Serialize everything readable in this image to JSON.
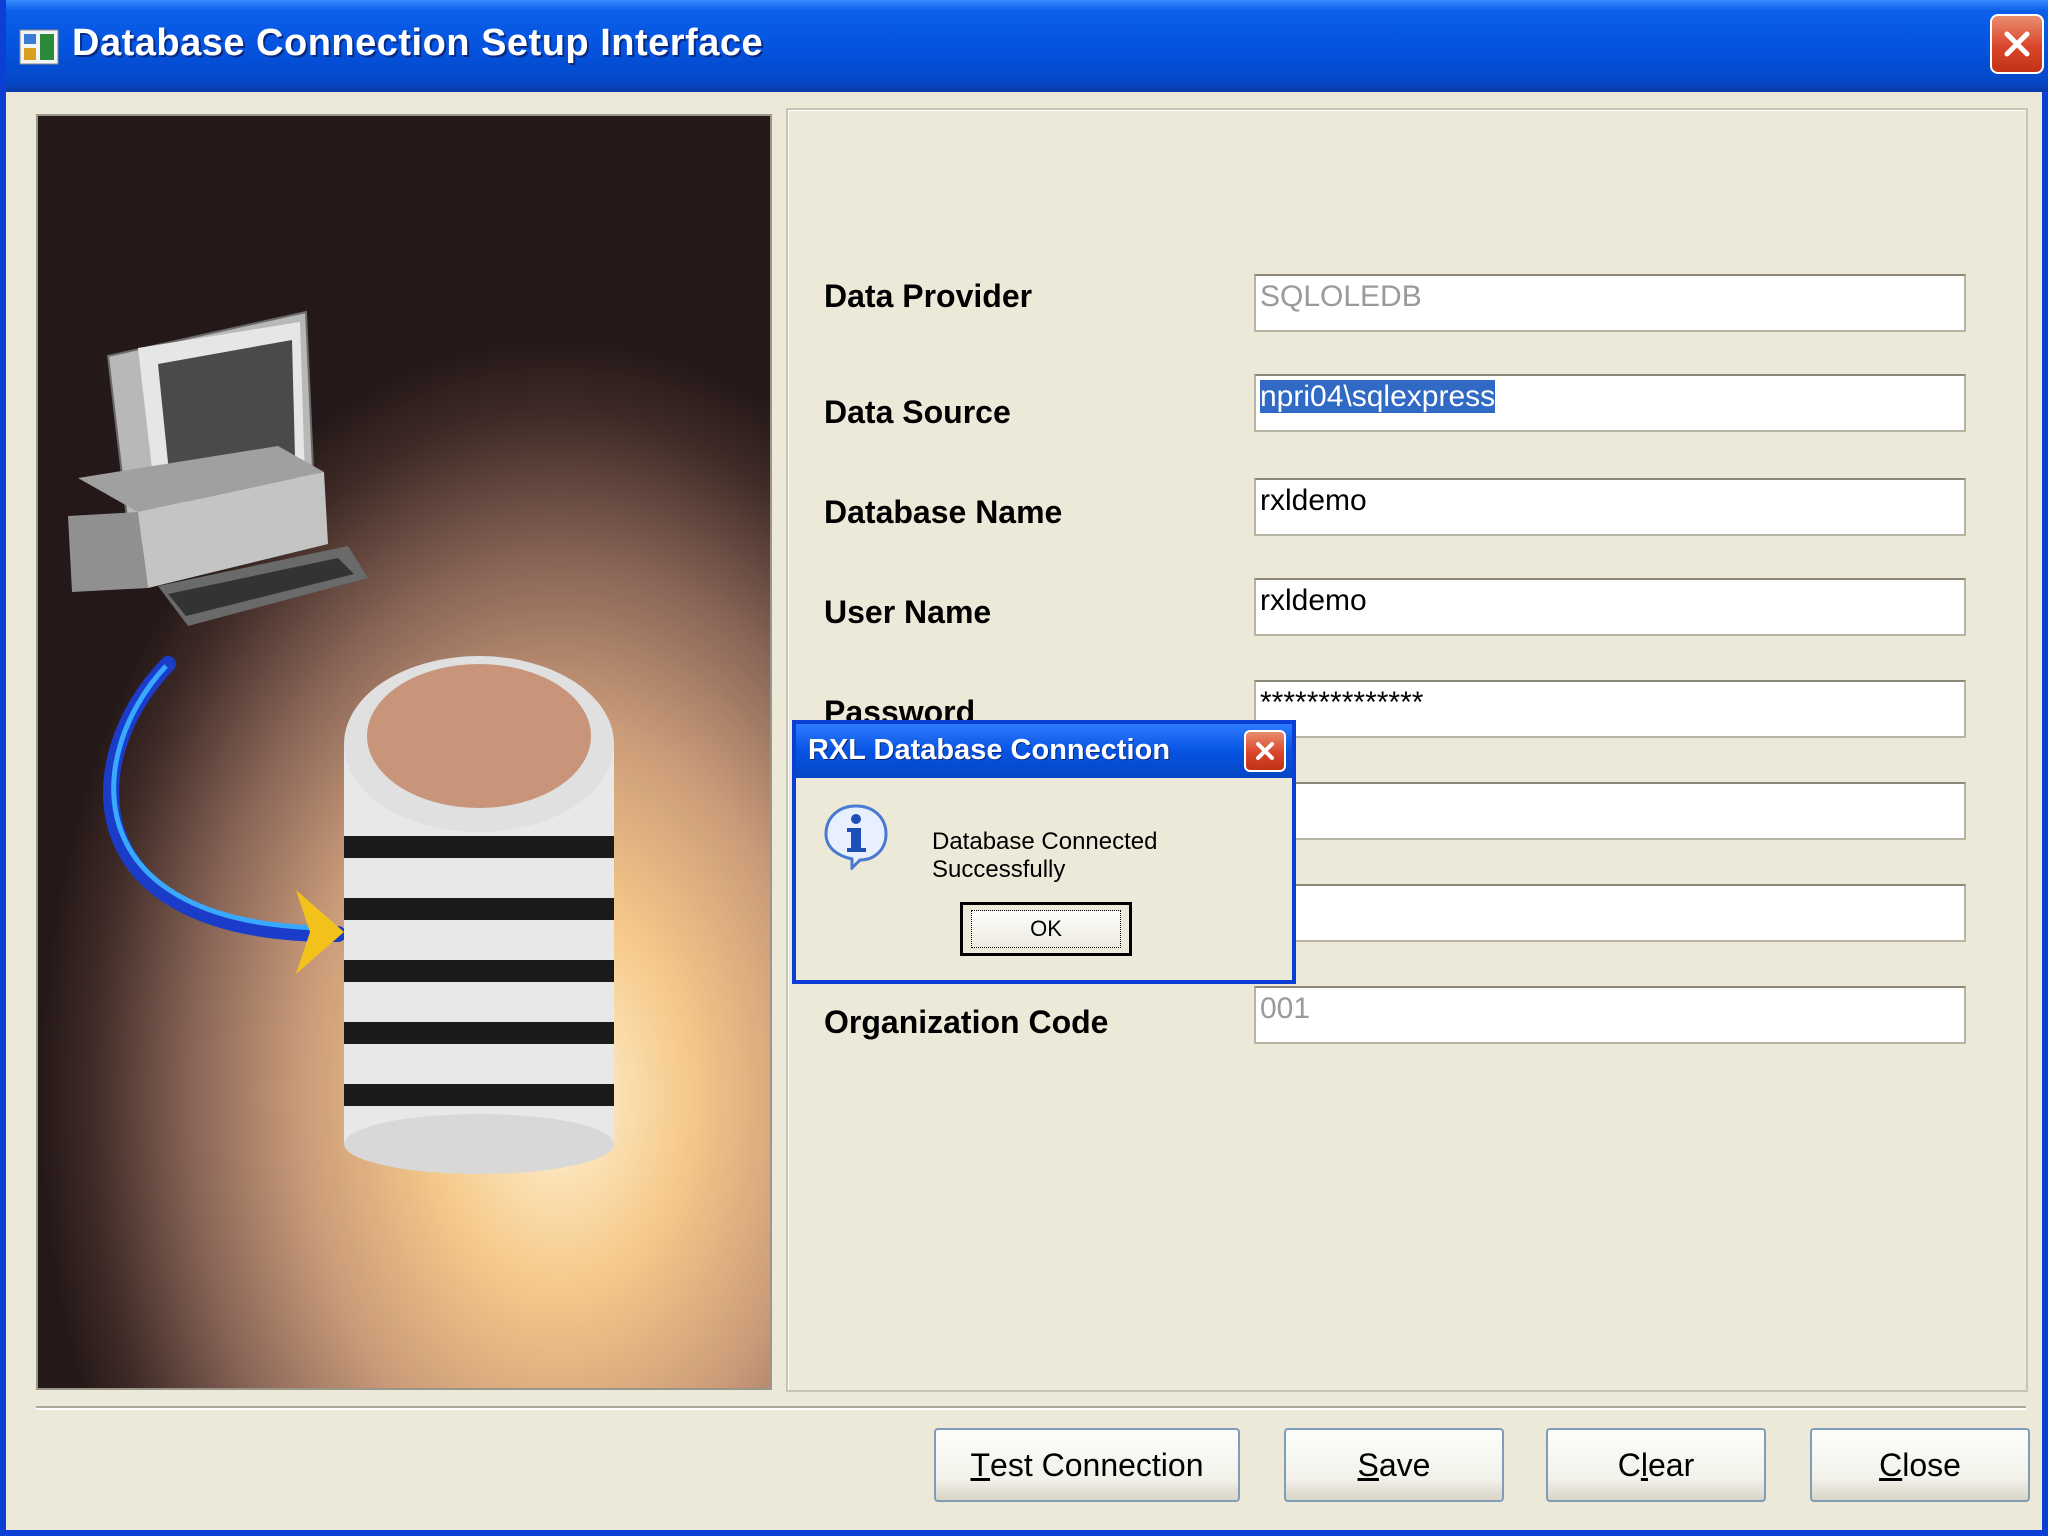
{
  "window": {
    "title": "Database Connection Setup Interface"
  },
  "form": {
    "fields": [
      {
        "label": "Data Provider",
        "value": "SQLOLEDB",
        "disabled": true
      },
      {
        "label": "Data Source",
        "value": "npri04\\sqlexpress",
        "selected": true
      },
      {
        "label": "Database Name",
        "value": "rxldemo"
      },
      {
        "label": "User Name",
        "value": "rxldemo"
      },
      {
        "label": "Password",
        "value": "**************"
      },
      {
        "label": "",
        "value": ""
      },
      {
        "label": "",
        "value": ""
      },
      {
        "label": "Organization Code",
        "value": "001",
        "disabled": true
      }
    ]
  },
  "buttons": {
    "test_connection": {
      "mnemonic": "T",
      "rest": "est Connection"
    },
    "save": {
      "mnemonic": "S",
      "rest": "ave"
    },
    "clear": {
      "pre": "C",
      "mnemonic": "l",
      "rest": "ear"
    },
    "close": {
      "mnemonic": "C",
      "rest": "lose"
    }
  },
  "dialog": {
    "title": "RXL Database Connection",
    "message": "Database Connected Successfully",
    "ok_label": "OK",
    "icon": "info-icon"
  },
  "colors": {
    "titlebar": "#0554e0",
    "selection": "#316ac5",
    "close_button": "#d9452a"
  }
}
